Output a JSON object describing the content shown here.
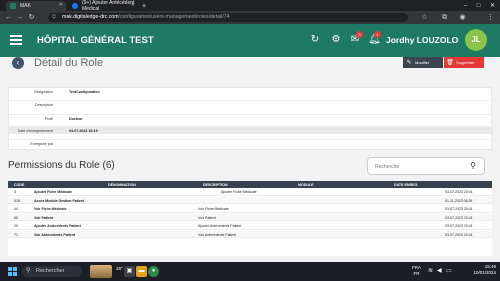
{
  "browser": {
    "tabs": [
      {
        "title": "MAK",
        "active": true
      },
      {
        "title": "(9+) Ajouter Antécédent Médical",
        "active": false
      }
    ],
    "new_tab": "+",
    "url_host": "mak.digitaledge-drc.com",
    "url_path": "/configuration/users-management/roles/detail/74"
  },
  "header": {
    "hospital": "HÔPITAL GÉNÉRAL TEST",
    "user_name": "Jordhy LOUZOLO",
    "avatar_initials": "JL",
    "badge_messages": "3",
    "badge_alerts": "1"
  },
  "page": {
    "title": "Détail du Role",
    "modify_label": "Modifier",
    "delete_label": "Supprimer"
  },
  "detail": {
    "fields": [
      {
        "label": "Désignation",
        "value": "TestConfiguration"
      },
      {
        "label": "Description",
        "value": ""
      },
      {
        "label": "Profil",
        "value": "Docteur"
      },
      {
        "label": "Date d'enregistrement",
        "value": "04-07-2023 15:19"
      },
      {
        "label": "Enrégistré par",
        "value": ""
      }
    ]
  },
  "permissions": {
    "title": "Permissions du Role (6)",
    "search_placeholder": "Recherche",
    "columns": [
      "CODE",
      "DÉNOMINATION",
      "DESCRIPTION",
      "MODULE",
      "DATE ENREG."
    ],
    "rows": [
      {
        "code": "3",
        "name": "Ajouter Fiche Médicale",
        "description": "Ajouter Fiche Médicale",
        "module": "",
        "date": "03-07-2023 20:41"
      },
      {
        "code": "518",
        "name": "Accès Module Gestion Patient",
        "description": "",
        "module": "",
        "date": "01-11-2023 06:25"
      },
      {
        "code": "44",
        "name": "Voir Fiche Médicale",
        "description": "Voir Fiche Médicale",
        "module": "",
        "date": "03-07-2023 20:41"
      },
      {
        "code": "65",
        "name": "Voir Patient",
        "description": "Voir Patient",
        "module": "",
        "date": "03-07-2023 20:41"
      },
      {
        "code": "29",
        "name": "Ajouter Antécédents Patient",
        "description": "Ajouter Antécédents Patient",
        "module": "",
        "date": "03-07-2023 20:41"
      },
      {
        "code": "71",
        "name": "Voir Antécédents Patient",
        "description": "Voir Antécédents Patient",
        "module": "",
        "date": "03-07-2023 20:41"
      }
    ]
  },
  "taskbar": {
    "search_label": "Rechercher",
    "weather": "28°",
    "lang": "FRA",
    "lang_sub": "FR",
    "time": "15:49",
    "date": "10/01/2024"
  },
  "colors": {
    "header": "#1f7a64",
    "delete": "#e53935",
    "table_header": "#37414d",
    "avatar": "#8bc34a"
  }
}
